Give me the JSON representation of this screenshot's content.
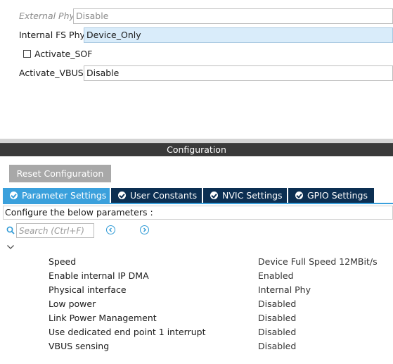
{
  "mode": {
    "external_phy": {
      "label": "External Phy",
      "value": "Disable"
    },
    "internal_fs_phy": {
      "label": "Internal FS Phy",
      "value": "Device_Only"
    },
    "activate_sof": {
      "label": "Activate_SOF",
      "checked": false
    },
    "activate_vbus": {
      "label": "Activate_VBUS",
      "value": "Disable"
    }
  },
  "configuration": {
    "header": "Configuration",
    "reset_label": "Reset Configuration",
    "tabs": [
      {
        "label": "Parameter Settings",
        "active": true
      },
      {
        "label": "User Constants",
        "active": false
      },
      {
        "label": "NVIC Settings",
        "active": false
      },
      {
        "label": "GPIO Settings",
        "active": false
      }
    ],
    "instruction": "Configure the below parameters :",
    "search_placeholder": "Search (Ctrl+F)",
    "parameters": [
      {
        "name": "Speed",
        "value": "Device Full Speed 12MBit/s"
      },
      {
        "name": "Enable internal IP DMA",
        "value": "Enabled"
      },
      {
        "name": "Physical interface",
        "value": "Internal Phy"
      },
      {
        "name": "Low power",
        "value": "Disabled"
      },
      {
        "name": "Link Power Management",
        "value": "Disabled"
      },
      {
        "name": "Use dedicated end point 1 interrupt",
        "value": "Disabled"
      },
      {
        "name": "VBUS sensing",
        "value": "Disabled"
      }
    ]
  },
  "colors": {
    "tab_active": "#3aa0dc",
    "tab_inactive": "#0c2f52",
    "header": "#3a3a3a",
    "reset_button": "#a8a8a8",
    "selected_field": "#d9ecfa"
  },
  "icons": {
    "search": "search-icon",
    "prev": "circle-chevron-left-icon",
    "next": "circle-chevron-right-icon",
    "collapse": "chevron-down-icon",
    "tab_check": "check-circle-icon"
  }
}
